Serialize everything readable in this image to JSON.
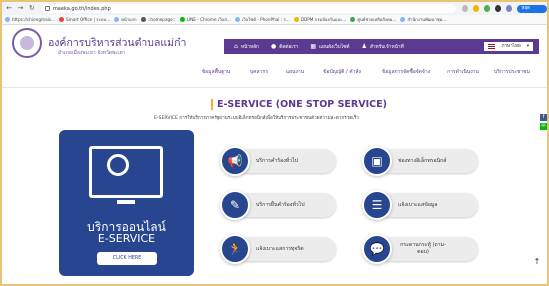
{
  "browser": {
    "url": "maeka.go.th/index.php",
    "bookmarks": [
      "https://chiengmais...",
      "Smart Office | ระบบ...",
      "หน้าแรก",
      "::homepage::",
      "LINE - Chrome เว็บส...",
      "เว็บไซต์ - PhonPhai : ร...",
      "DDPM กรมป้องกันและ...",
      "ศูนย์ช่วยเหลือสังคม...",
      "สำนักงานพัฒนาชุม..."
    ],
    "profile_label": "หยุดชั่วคราว"
  },
  "header": {
    "org_name": "องค์การบริหารส่วนตำบลแม่ก๋า",
    "org_sub": "อำเภอเมืองพะเยา จังหวัดพะเยา",
    "topnav": [
      {
        "icon": "home-icon",
        "glyph": "⌂",
        "label": "หน้าหลัก"
      },
      {
        "icon": "person-icon",
        "glyph": "●",
        "label": "ติดต่อเรา"
      },
      {
        "icon": "sitemap-icon",
        "glyph": "▦",
        "label": "แผนผังเว็บไซต์"
      },
      {
        "icon": "people-icon",
        "glyph": "♟",
        "label": "สำหรับเจ้าหน้าที่"
      }
    ],
    "lang": "ภาษาไทย",
    "lang_arrow": "▾",
    "subnav": [
      "ข้อมูลพื้นฐาน",
      "บุคลากร",
      "แผนงาน",
      "ข้อบัญญัติ / คำสั่ง",
      "ข้อมูลการจัดซื้อจัดจ้าง",
      "การดำเนินงาน",
      "บริการประชาชน"
    ]
  },
  "main": {
    "title": "E-SERVICE (ONE STOP SERVICE)",
    "description": "E-SERVICE การให้บริการภาครัฐผ่านระบบอิเล็กทรอนิกส์เพื่อให้บริการประชาชนด้วยความสะดวกรวดเร็ว",
    "hero_line1": "บริการออนไลน์",
    "hero_line2": "E-SERVICE",
    "hero_button": "CLICK HERE",
    "services": [
      {
        "icon": "megaphone-icon",
        "glyph": "📢",
        "label": "บริการคำร้องทั่วไป"
      },
      {
        "icon": "presentation-icon",
        "glyph": "▣",
        "label": "ช่องทางอิเล็กทรอนิกส์"
      },
      {
        "icon": "form-icon",
        "glyph": "✎",
        "label": "บริการยื่นคำร้องทั่วไป"
      },
      {
        "icon": "complaint-board-icon",
        "glyph": "☰",
        "label": "แจ้งเบาะแสข้อมูล"
      },
      {
        "icon": "running-person-icon",
        "glyph": "🏃",
        "label": "แจ้งเบาะแสการทุจริต"
      },
      {
        "icon": "chat-icon",
        "glyph": "💬",
        "label": "กระดานกระทู้ (ถาม-ตอบ)"
      }
    ]
  },
  "side_tabs": [
    {
      "label": "f",
      "color": "#3b5998"
    },
    {
      "label": "✉",
      "color": "#00b900"
    }
  ],
  "scroll_top": "↑"
}
